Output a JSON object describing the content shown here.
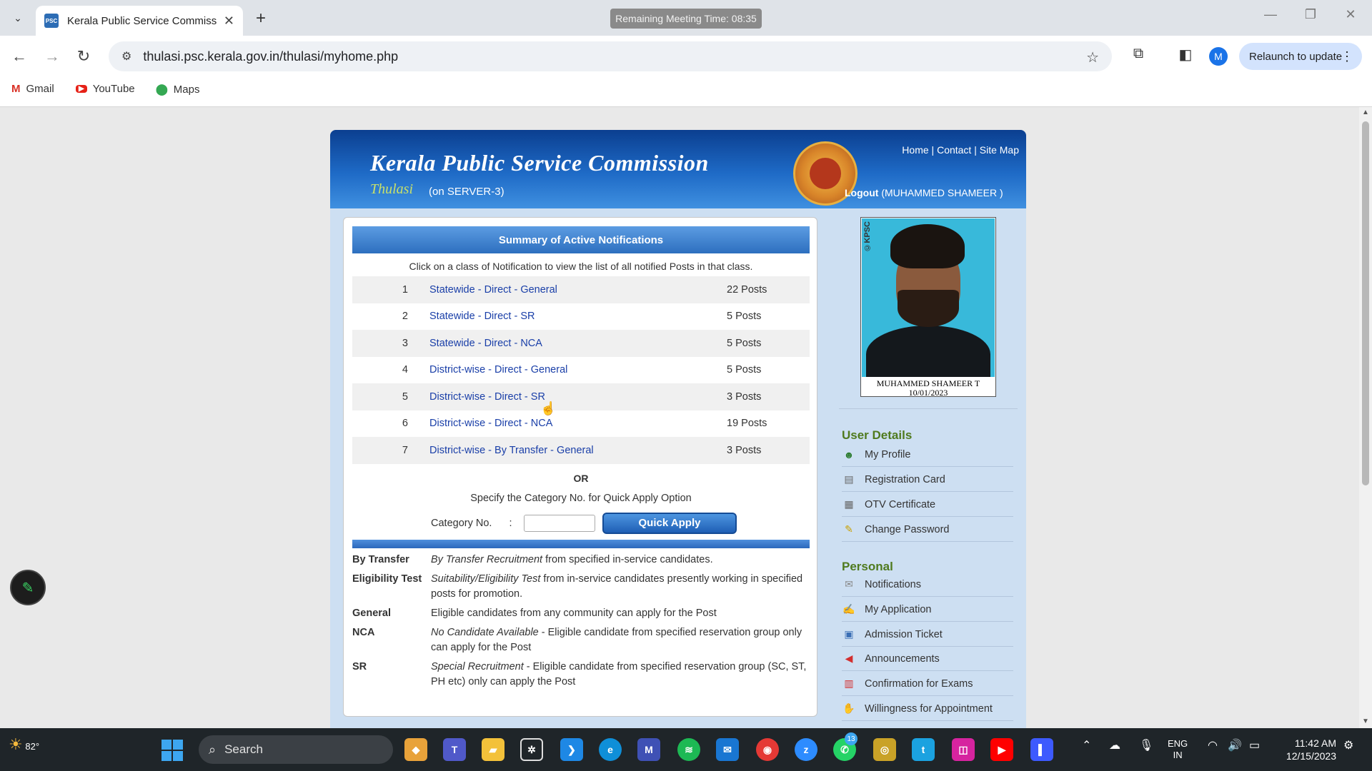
{
  "browser": {
    "tab_title": "Kerala Public Service Commissio",
    "favicon_text": "PSC",
    "meeting_timer": "Remaining Meeting Time: 08:35",
    "url": "thulasi.psc.kerala.gov.in/thulasi/myhome.php",
    "profile_initial": "M",
    "relaunch_label": "Relaunch to update",
    "bookmarks": [
      {
        "label": "Gmail",
        "icon": "gmail-icon"
      },
      {
        "label": "YouTube",
        "icon": "youtube-icon"
      },
      {
        "label": "Maps",
        "icon": "maps-icon"
      }
    ]
  },
  "site": {
    "title": "Kerala Public Service Commission",
    "logo_text": "Thulasi",
    "server": "(on SERVER-3)",
    "top_links": {
      "home": "Home",
      "contact": "Contact",
      "sitemap": "Site Map"
    },
    "logout": "Logout",
    "user_paren": "(MUHAMMED SHAMEER )"
  },
  "summary": {
    "header": "Summary of Active Notifications",
    "intro": "Click on a class of Notification to view the list of all notified Posts in that class.",
    "rows": [
      {
        "num": "1",
        "label": "Statewide - Direct - General",
        "count": "22 Posts"
      },
      {
        "num": "2",
        "label": "Statewide - Direct - SR",
        "count": "5 Posts"
      },
      {
        "num": "3",
        "label": "Statewide - Direct - NCA",
        "count": "5 Posts"
      },
      {
        "num": "4",
        "label": "District-wise - Direct - General",
        "count": "5 Posts"
      },
      {
        "num": "5",
        "label": "District-wise - Direct - SR",
        "count": "3 Posts"
      },
      {
        "num": "6",
        "label": "District-wise - Direct - NCA",
        "count": "19 Posts"
      },
      {
        "num": "7",
        "label": "District-wise - By Transfer - General",
        "count": "3 Posts"
      }
    ],
    "or_text": "OR",
    "quick_apply_text": "Specify the Category No. for Quick Apply Option",
    "category_label": "Category No.",
    "category_colon": ":",
    "category_value": "",
    "quick_apply_button": "Quick Apply"
  },
  "definitions": [
    {
      "term": "By Transfer",
      "italic": "By Transfer Recruitment",
      "rest": " from specified in-service candidates."
    },
    {
      "term": "Eligibility Test",
      "italic": "Suitability/Eligibility Test",
      "rest": " from in-service candidates presently working in specified posts for promotion."
    },
    {
      "term": "General",
      "italic": "",
      "rest": "Eligible candidates from any community can apply for the Post"
    },
    {
      "term": "NCA",
      "italic": "No Candidate Available",
      "rest": " - Eligible candidate from specified reservation group only can apply for the Post"
    },
    {
      "term": "SR",
      "italic": "Special Recruitment",
      "rest": " - Eligible candidate from specified reservation group (SC, ST, PH etc) only can apply the Post"
    }
  ],
  "profile": {
    "stamp": "©KPSC",
    "name": "MUHAMMED SHAMEER T",
    "date": "10/01/2023"
  },
  "sidebar": {
    "user_details_title": "User Details",
    "user_details": [
      {
        "label": "My Profile",
        "icon": "profile-icon"
      },
      {
        "label": "Registration Card",
        "icon": "card-icon"
      },
      {
        "label": "OTV Certificate",
        "icon": "certificate-icon"
      },
      {
        "label": "Change Password",
        "icon": "password-icon"
      }
    ],
    "personal_title": "Personal",
    "personal": [
      {
        "label": "Notifications",
        "icon": "notifications-icon"
      },
      {
        "label": "My Application",
        "icon": "application-icon"
      },
      {
        "label": "Admission Ticket",
        "icon": "ticket-icon"
      },
      {
        "label": "Announcements",
        "icon": "megaphone-icon"
      },
      {
        "label": "Confirmation for Exams",
        "icon": "calendar-icon"
      },
      {
        "label": "Willingness for Appointment",
        "icon": "handshake-icon"
      }
    ]
  },
  "taskbar": {
    "temperature": "82°",
    "search_label": "Search",
    "whatsapp_badge": "13",
    "lang_line1": "ENG",
    "lang_line2": "IN",
    "time": "11:42 AM",
    "date": "12/15/2023"
  },
  "colors": {
    "link": "#1a3fa8",
    "section_title": "#4f7a1e",
    "banner_blue": "#1e6ac6"
  }
}
